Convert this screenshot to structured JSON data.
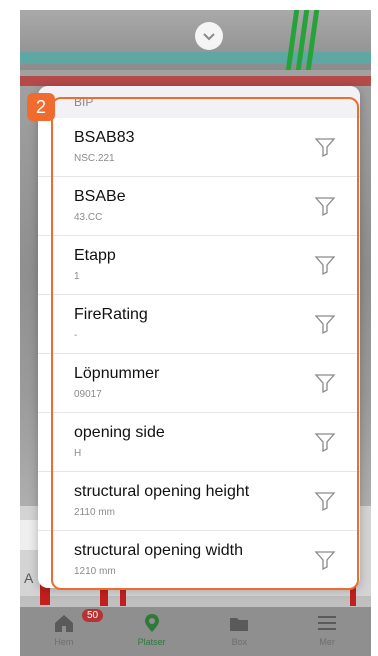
{
  "background_scene": {
    "chevron_icon": "chevron-down-icon"
  },
  "annotation": {
    "badge": "2"
  },
  "sheet": {
    "section_title": "BIP",
    "rows": [
      {
        "name": "BSAB83",
        "value": "NSC.221"
      },
      {
        "name": "BSABe",
        "value": "43.CC"
      },
      {
        "name": "Etapp",
        "value": "1"
      },
      {
        "name": "FireRating",
        "value": "-"
      },
      {
        "name": "Löpnummer",
        "value": "09017"
      },
      {
        "name": "opening side",
        "value": "H"
      },
      {
        "name": "structural opening height",
        "value": "2110 mm"
      },
      {
        "name": "structural opening width",
        "value": "1210 mm"
      }
    ],
    "filter_icon": "filter-icon"
  },
  "left_overlay_text": "A",
  "tabbar": {
    "tabs": [
      {
        "label": "Hem",
        "icon": "home-icon",
        "badge": "50"
      },
      {
        "label": "Platser",
        "icon": "location-pin-icon"
      },
      {
        "label": "Box",
        "icon": "folder-icon"
      },
      {
        "label": "Mer",
        "icon": "menu-icon"
      }
    ]
  },
  "colors": {
    "accent": "#ef6b2e",
    "active_tab": "#2f7a38",
    "badge": "#b73232"
  }
}
